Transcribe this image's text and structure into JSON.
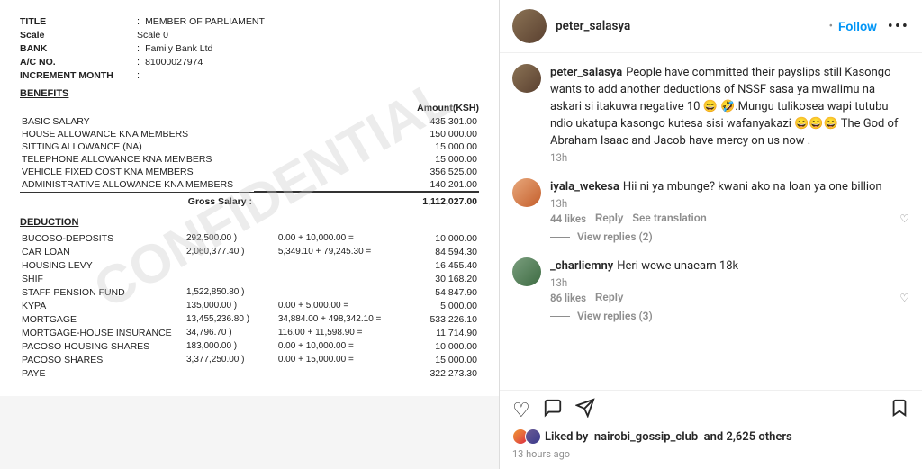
{
  "payslip": {
    "title_label": "TITLE",
    "title_value": "MEMBER OF PARLIAMENT",
    "scale_label": "Scale",
    "scale_value": "Scale 0",
    "bank_label": "BANK",
    "bank_value": "Family Bank Ltd",
    "acno_label": "A/C NO.",
    "acno_value": "81000027974",
    "increment_label": "INCREMENT MONTH",
    "increment_value": "",
    "benefits_title": "BENEFITS",
    "amount_header": "Amount(KSH)",
    "benefits": [
      {
        "name": "BASIC SALARY",
        "amount": "435,301.00"
      },
      {
        "name": "HOUSE ALLOWANCE KNA MEMBERS",
        "amount": "150,000.00"
      },
      {
        "name": "SITTING ALLOWANCE (NA)",
        "amount": "15,000.00"
      },
      {
        "name": "TELEPHONE ALLOWANCE KNA MEMBERS",
        "amount": "15,000.00"
      },
      {
        "name": "VEHICLE FIXED COST KNA MEMBERS",
        "amount": "356,525.00"
      },
      {
        "name": "ADMINISTRATIVE ALLOWANCE KNA MEMBERS",
        "amount": "140,201.00"
      }
    ],
    "gross_label": "Gross Salary :",
    "gross_amount": "1,112,027.00",
    "deduction_title": "DEDUCTION",
    "deductions": [
      {
        "name": "BUCOSO-DEPOSITS",
        "col2": "292,500.00 )",
        "col3": "0.00 + 10,000.00 =",
        "amount": "10,000.00"
      },
      {
        "name": "CAR LOAN",
        "col2": "2,060,377.40 )",
        "col3": "5,349.10 + 79,245.30 =",
        "amount": "84,594.30"
      },
      {
        "name": "HOUSING LEVY",
        "col2": "",
        "col3": "",
        "amount": "16,455.40"
      },
      {
        "name": "SHIF",
        "col2": "",
        "col3": "",
        "amount": "30,168.20"
      },
      {
        "name": "STAFF PENSION FUND",
        "col2": "1,522,850.80 )",
        "col3": "",
        "amount": "54,847.90"
      },
      {
        "name": "KYPA",
        "col2": "135,000.00 )",
        "col3": "0.00 + 5,000.00 =",
        "amount": "5,000.00"
      },
      {
        "name": "MORTGAGE",
        "col2": "13,455,236.80 )",
        "col3": "34,884.00 + 498,342.10 =",
        "amount": "533,226.10"
      },
      {
        "name": "MORTGAGE-HOUSE INSURANCE",
        "col2": "34,796.70 )",
        "col3": "116.00 + 11,598.90 =",
        "amount": "11,714.90"
      },
      {
        "name": "PACOSO HOUSING SHARES",
        "col2": "183,000.00 )",
        "col3": "0.00 + 10,000.00 =",
        "amount": "10,000.00"
      },
      {
        "name": "PACOSO SHARES",
        "col2": "3,377,250.00 )",
        "col3": "0.00 + 15,000.00 =",
        "amount": "15,000.00"
      },
      {
        "name": "PAYE",
        "col2": "",
        "col3": "",
        "amount": "322,273.30"
      }
    ]
  },
  "instagram": {
    "username": "peter_salasya",
    "follow_label": "Follow",
    "more_icon": "•••",
    "main_comment": {
      "username": "peter_salasya",
      "text": " People have committed their payslips still Kasongo wants to add another deductions of NSSF sasa ya mwalimu na askari si itakuwa negative 10 😄 🤣.Mungu tulikosea wapi tutubu ndio ukatupa kasongo kutesa sisi wafanyakazi 😄😄😄 The God of Abraham Isaac and Jacob have mercy on us now .",
      "time": "13h"
    },
    "comments": [
      {
        "username": "iyala_wekesa",
        "text": " Hii ni ya mbunge? kwani ako na loan ya one billion",
        "time": "13h",
        "likes": "44 likes",
        "reply_label": "Reply",
        "translate_label": "See translation",
        "view_replies_label": "View replies (2)"
      },
      {
        "username": "_charliemny",
        "text": " Heri wewe unaearn 18k",
        "time": "13h",
        "likes": "86 likes",
        "reply_label": "Reply",
        "view_replies_label": "View replies (3)"
      }
    ],
    "liked_by_label": "Liked by",
    "liked_username": "nairobi_gossip_club",
    "liked_others": "and 2,625 others",
    "time_ago": "13 hours ago"
  }
}
